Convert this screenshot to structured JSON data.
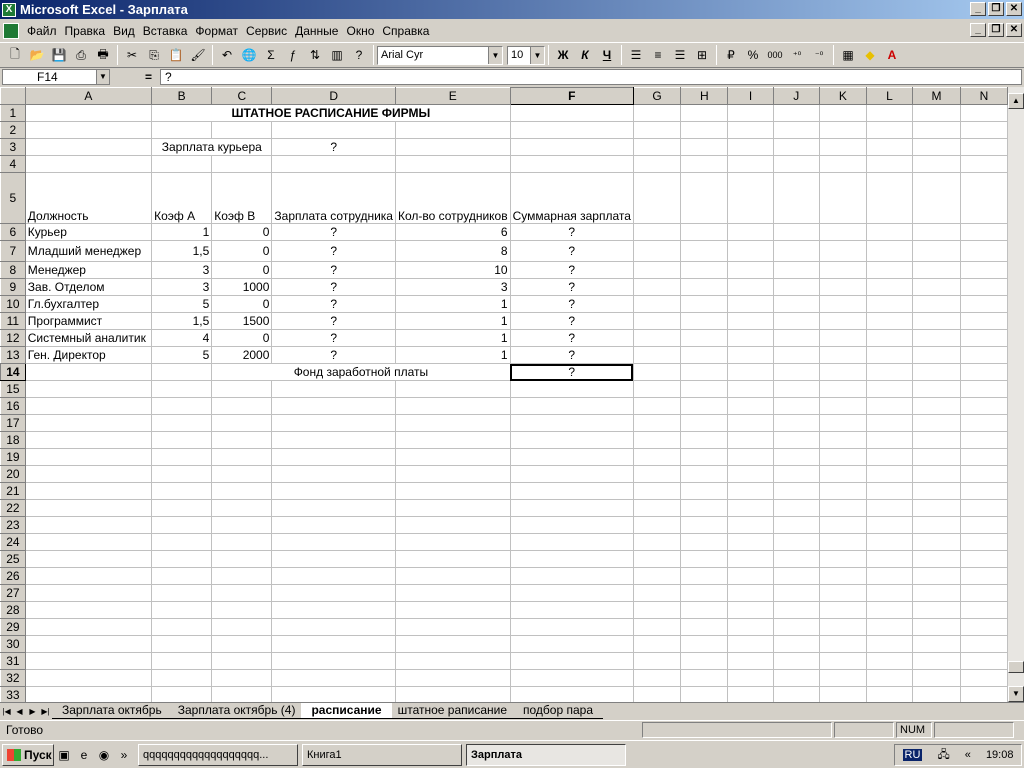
{
  "window": {
    "title": "Microsoft Excel - Зарплата",
    "minimize": "_",
    "restore": "❐",
    "close": "✕"
  },
  "menu": [
    "Файл",
    "Правка",
    "Вид",
    "Вставка",
    "Формат",
    "Сервис",
    "Данные",
    "Окно",
    "Справка"
  ],
  "toolbar": {
    "font": "Arial Cyr",
    "size": "10",
    "bold": "Ж",
    "italic": "К",
    "underline": "Ч",
    "percent": "%",
    "thousands": "000"
  },
  "formula_bar": {
    "cell": "F14",
    "equals": "=",
    "value": "?"
  },
  "columns": [
    "A",
    "B",
    "C",
    "D",
    "E",
    "F",
    "G",
    "H",
    "I",
    "J",
    "K",
    "L",
    "M",
    "N"
  ],
  "rows": {
    "r1": {
      "b": "ШТАТНОЕ РАСПИСАНИЕ ФИРМЫ"
    },
    "r3": {
      "b": "Зарплата курьера",
      "d": "?"
    },
    "r5": {
      "a": "Должность",
      "b": "Коэф А",
      "c": "Коэф В",
      "d": "Зарплата сотрудника",
      "e": "Кол-во сотрудников",
      "f": "Суммарная зарплата"
    },
    "r6": {
      "a": "Курьер",
      "b": "1",
      "c": "0",
      "d": "?",
      "e": "6",
      "f": "?"
    },
    "r7": {
      "a": "Младший менеджер",
      "b": "1,5",
      "c": "0",
      "d": "?",
      "e": "8",
      "f": "?"
    },
    "r8": {
      "a": "Менеджер",
      "b": "3",
      "c": "0",
      "d": "?",
      "e": "10",
      "f": "?"
    },
    "r9": {
      "a": "Зав. Отделом",
      "b": "3",
      "c": "1000",
      "d": "?",
      "e": "3",
      "f": "?"
    },
    "r10": {
      "a": "Гл.бухгалтер",
      "b": "5",
      "c": "0",
      "d": "?",
      "e": "1",
      "f": "?"
    },
    "r11": {
      "a": "Программист",
      "b": "1,5",
      "c": "1500",
      "d": "?",
      "e": "1",
      "f": "?"
    },
    "r12": {
      "a": "Системный аналитик",
      "b": "4",
      "c": "0",
      "d": "?",
      "e": "1",
      "f": "?"
    },
    "r13": {
      "a": "Ген. Директор",
      "b": "5",
      "c": "2000",
      "d": "?",
      "e": "1",
      "f": "?"
    },
    "r14": {
      "c": "Фонд заработной платы",
      "f": "?"
    }
  },
  "sheet_tabs": [
    "Зарплата октябрь",
    "Зарплата октябрь (4)",
    "расписание",
    "штатное раписание",
    "подбор пара"
  ],
  "active_tab": "расписание",
  "status": {
    "text": "Готово",
    "num": "NUM"
  },
  "taskbar": {
    "start": "Пуск",
    "items": [
      "qqqqqqqqqqqqqqqqqqq...",
      "Книга1",
      "Зарплата"
    ],
    "lang": "RU",
    "time": "19:08"
  }
}
